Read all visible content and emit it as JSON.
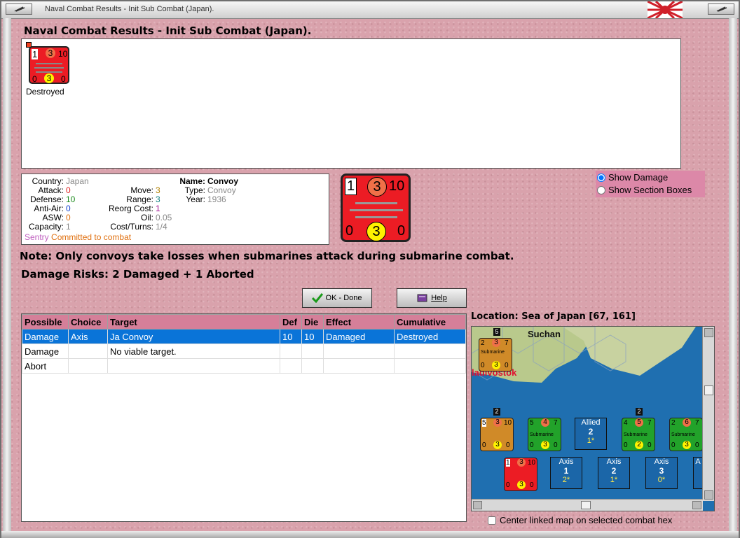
{
  "window": {
    "title": "Naval Combat Results - Init Sub Combat (Japan)."
  },
  "header": {
    "heading": "Naval Combat Results - Init Sub Combat (Japan)."
  },
  "result_panel": {
    "unit_status": "Destroyed",
    "counter": {
      "tl": "1",
      "tm": "3",
      "tr": "10",
      "bl": "0",
      "bm": "3",
      "br": "0"
    }
  },
  "unit_info": {
    "country_label": "Country:",
    "country": "Japan",
    "attack_label": "Attack:",
    "attack": "0",
    "defense_label": "Defense:",
    "defense": "10",
    "antiair_label": "Anti-Air:",
    "antiair": "0",
    "asw_label": "ASW:",
    "asw": "0",
    "capacity_label": "Capacity:",
    "capacity": "1",
    "move_label": "Move:",
    "move": "3",
    "range_label": "Range:",
    "range": "3",
    "reorg_label": "Reorg Cost:",
    "reorg": "1",
    "oil_label": "Oil:",
    "oil": "0.05",
    "cost_label": "Cost/Turns:",
    "cost": "1/4",
    "name_label": "Name:",
    "name": "Convoy",
    "type_label": "Type:",
    "type": "Convoy",
    "year_label": "Year:",
    "year": "1936",
    "sentry": "Sentry",
    "committed": "Committed to combat"
  },
  "big_counter": {
    "tl": "1",
    "tm": "3",
    "tr": "10",
    "bl": "0",
    "bm": "3",
    "br": "0"
  },
  "options": {
    "show_damage": "Show Damage",
    "show_sections": "Show Section Boxes",
    "selected": "show_damage"
  },
  "note": "Note: Only convoys take losses when submarines attack during submarine combat.",
  "damage_risks": "Damage Risks:  2 Damaged + 1 Aborted",
  "buttons": {
    "ok": "OK - Done",
    "help": "Help"
  },
  "table": {
    "headers": [
      "Possible",
      "Choice",
      "Target",
      "Def",
      "Die",
      "Effect",
      "Cumulative"
    ],
    "rows": [
      [
        "Damage",
        "Axis",
        "Ja Convoy",
        "10",
        "10",
        "Damaged",
        "Destroyed"
      ],
      [
        "Damage",
        "",
        "No viable target.",
        "",
        "",
        "",
        ""
      ],
      [
        "Abort",
        "",
        "",
        "",
        "",
        "",
        ""
      ]
    ],
    "selected_row": 0
  },
  "location": {
    "label": "Location:  Sea of Japan [67, 161]"
  },
  "map": {
    "city1": "Suchan",
    "city2": "ladivostok",
    "sub_counter_label": "Submarine",
    "units": [
      {
        "label": "Submarine",
        "tl": "2",
        "tm": "3",
        "tr": "7",
        "bl": "0",
        "bm": "3",
        "br": "0",
        "stack": "5"
      },
      {
        "label": "",
        "tl": "5",
        "tm": "3",
        "tr": "10",
        "bl": "0",
        "bm": "3",
        "br": "0",
        "stack": "2"
      },
      {
        "label": "Submarine",
        "tl": "5",
        "tm": "4",
        "tr": "7",
        "bl": "0",
        "bm": "3",
        "br": "0"
      },
      {
        "label": "Submarine",
        "tl": "4",
        "tm": "5",
        "tr": "7",
        "bl": "0",
        "bm": "2",
        "br": "0",
        "stack": "2"
      },
      {
        "label": "Submarine",
        "tl": "2",
        "tm": "6",
        "tr": "7",
        "bl": "0",
        "bm": "3",
        "br": "0"
      },
      {
        "label": "",
        "tl": "1",
        "tm": "3",
        "tr": "10",
        "bl": "0",
        "bm": "3",
        "br": "0"
      }
    ],
    "groups": [
      {
        "side": "Allied",
        "num": "2",
        "sub": "1*"
      },
      {
        "side": "Axis",
        "num": "1",
        "sub": "2*"
      },
      {
        "side": "Axis",
        "num": "2",
        "sub": "1*"
      },
      {
        "side": "Axis",
        "num": "3",
        "sub": "0*"
      },
      {
        "side": "A",
        "num": "",
        "sub": ""
      }
    ]
  },
  "center_map": "Center linked map on selected combat hex",
  "colors": {
    "background": "#d9a2ac",
    "counter_red": "#ec1c24",
    "header_pink": "#d57f99",
    "selection": "#0a74d8",
    "sea": "#1f6fb0"
  }
}
